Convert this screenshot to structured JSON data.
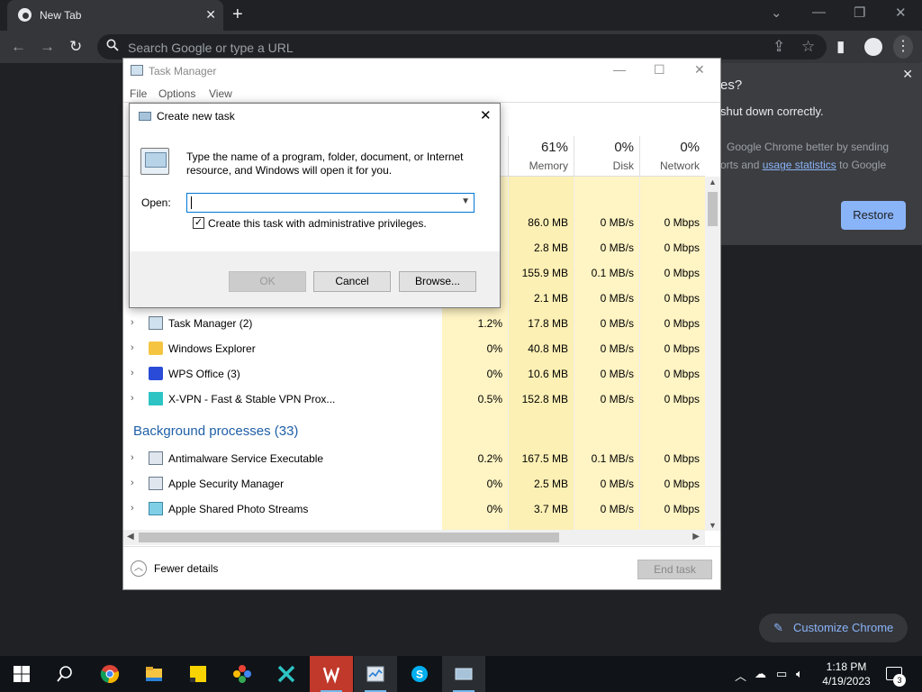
{
  "chrome": {
    "tab_title": "New Tab",
    "omnibox_placeholder": "Search Google or type a URL",
    "restore_heading": "es?",
    "restore_sub": "shut down correctly.",
    "restore_button": "Restore",
    "consent_line1": "Google Chrome better by sending",
    "consent_line2_prefix": "Ports and",
    "consent_link": "usage statistics",
    "consent_line2_suffix": "to Google",
    "customize_button": "Customize Chrome"
  },
  "task_manager": {
    "title": "Task Manager",
    "menu": [
      "File",
      "Options",
      "View"
    ],
    "columns": [
      {
        "pct": "61%",
        "label": "Memory"
      },
      {
        "pct": "0%",
        "label": "Disk"
      },
      {
        "pct": "0%",
        "label": "Network"
      }
    ],
    "rows": [
      {
        "name": "",
        "cpu": "",
        "memory": "86.0 MB",
        "disk": "0 MB/s",
        "network": "0 Mbps"
      },
      {
        "name": "",
        "cpu": "",
        "memory": "2.8 MB",
        "disk": "0 MB/s",
        "network": "0 Mbps"
      },
      {
        "name": "",
        "cpu": "",
        "memory": "155.9 MB",
        "disk": "0.1 MB/s",
        "network": "0 Mbps"
      },
      {
        "name": "",
        "cpu": "",
        "memory": "2.1 MB",
        "disk": "0 MB/s",
        "network": "0 Mbps"
      },
      {
        "name": "Task Manager (2)",
        "cpu": "1.2%",
        "memory": "17.8 MB",
        "disk": "0 MB/s",
        "network": "0 Mbps"
      },
      {
        "name": "Windows Explorer",
        "cpu": "0%",
        "memory": "40.8 MB",
        "disk": "0 MB/s",
        "network": "0 Mbps"
      },
      {
        "name": "WPS Office (3)",
        "cpu": "0%",
        "memory": "10.6 MB",
        "disk": "0 MB/s",
        "network": "0 Mbps"
      },
      {
        "name": "X-VPN - Fast & Stable VPN Prox...",
        "cpu": "0.5%",
        "memory": "152.8 MB",
        "disk": "0 MB/s",
        "network": "0 Mbps"
      }
    ],
    "background_title": "Background processes (33)",
    "background_rows": [
      {
        "name": "Antimalware Service Executable",
        "cpu": "0.2%",
        "memory": "167.5 MB",
        "disk": "0.1 MB/s",
        "network": "0 Mbps"
      },
      {
        "name": "Apple Security Manager",
        "cpu": "0%",
        "memory": "2.5 MB",
        "disk": "0 MB/s",
        "network": "0 Mbps"
      },
      {
        "name": "Apple Shared Photo Streams",
        "cpu": "0%",
        "memory": "3.7 MB",
        "disk": "0 MB/s",
        "network": "0 Mbps"
      }
    ],
    "fewer_details": "Fewer details",
    "end_task": "End task"
  },
  "dialog": {
    "title": "Create new task",
    "description": "Type the name of a program, folder, document, or Internet resource, and Windows will open it for you.",
    "open_label": "Open:",
    "open_value": "",
    "admin_checkbox_label": "Create this task with administrative privileges.",
    "admin_checked": true,
    "ok": "OK",
    "cancel": "Cancel",
    "browse": "Browse..."
  },
  "taskbar": {
    "time": "1:18 PM",
    "date": "4/19/2023",
    "notification_count": "3",
    "apps": [
      "start-icon",
      "search-icon",
      "chrome-icon",
      "file-explorer-icon",
      "sticky-notes-icon",
      "photos-icon",
      "x-vpn-icon",
      "wps-office-icon",
      "task-manager-icon",
      "skype-icon",
      "run-dialog-icon"
    ]
  }
}
